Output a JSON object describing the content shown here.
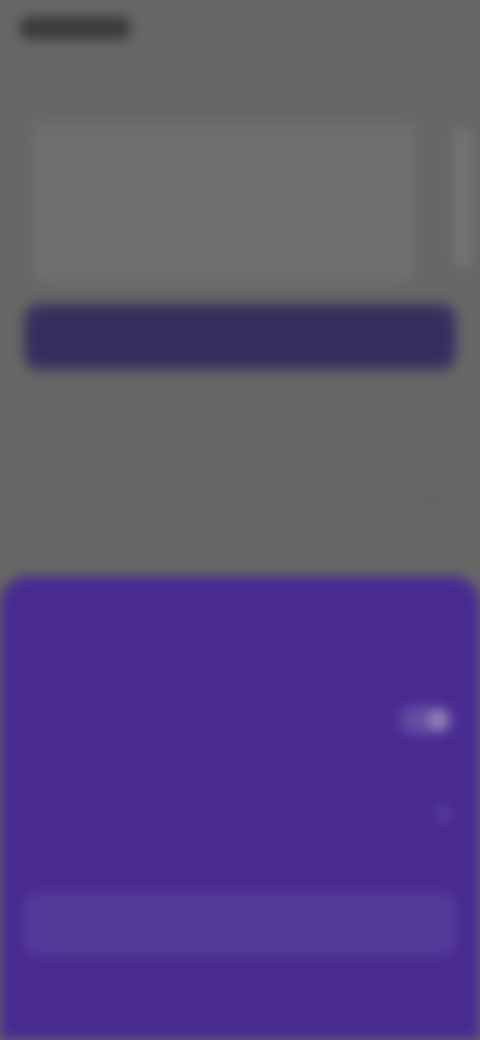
{
  "app": {
    "status_time": "",
    "background_title": "",
    "card": {
      "line1": "",
      "line2": ""
    },
    "primary_button_label": "",
    "helper_text": "",
    "list_item_label": ""
  },
  "sheet": {
    "title": "",
    "toggle": {
      "label": "",
      "sublabel": ""
    },
    "option": {
      "label": "",
      "sublabel": ""
    },
    "info_text": "",
    "danger_link_label": ""
  },
  "colors": {
    "sheet_bg": "#4c2d99",
    "danger": "#d3477a",
    "background_dim": "#6d6d6d"
  }
}
